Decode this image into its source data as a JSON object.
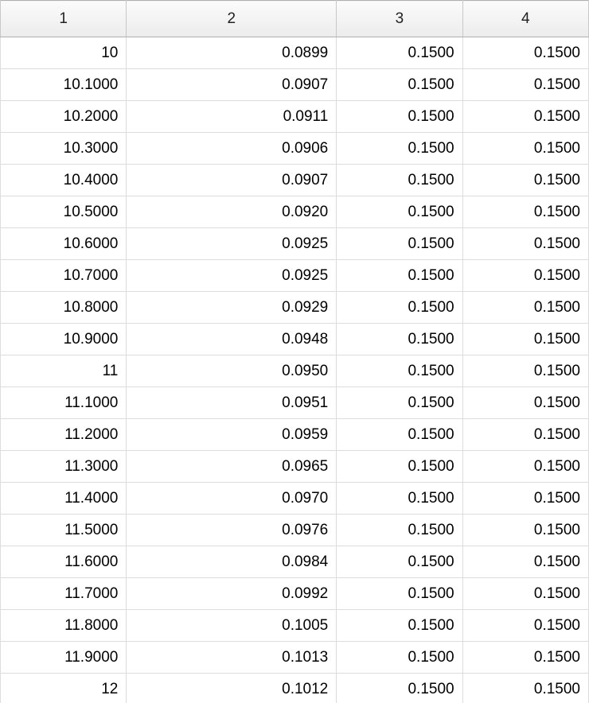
{
  "table": {
    "headers": [
      "1",
      "2",
      "3",
      "4"
    ],
    "rows": [
      [
        "10",
        "0.0899",
        "0.1500",
        "0.1500"
      ],
      [
        "10.1000",
        "0.0907",
        "0.1500",
        "0.1500"
      ],
      [
        "10.2000",
        "0.0911",
        "0.1500",
        "0.1500"
      ],
      [
        "10.3000",
        "0.0906",
        "0.1500",
        "0.1500"
      ],
      [
        "10.4000",
        "0.0907",
        "0.1500",
        "0.1500"
      ],
      [
        "10.5000",
        "0.0920",
        "0.1500",
        "0.1500"
      ],
      [
        "10.6000",
        "0.0925",
        "0.1500",
        "0.1500"
      ],
      [
        "10.7000",
        "0.0925",
        "0.1500",
        "0.1500"
      ],
      [
        "10.8000",
        "0.0929",
        "0.1500",
        "0.1500"
      ],
      [
        "10.9000",
        "0.0948",
        "0.1500",
        "0.1500"
      ],
      [
        "11",
        "0.0950",
        "0.1500",
        "0.1500"
      ],
      [
        "11.1000",
        "0.0951",
        "0.1500",
        "0.1500"
      ],
      [
        "11.2000",
        "0.0959",
        "0.1500",
        "0.1500"
      ],
      [
        "11.3000",
        "0.0965",
        "0.1500",
        "0.1500"
      ],
      [
        "11.4000",
        "0.0970",
        "0.1500",
        "0.1500"
      ],
      [
        "11.5000",
        "0.0976",
        "0.1500",
        "0.1500"
      ],
      [
        "11.6000",
        "0.0984",
        "0.1500",
        "0.1500"
      ],
      [
        "11.7000",
        "0.0992",
        "0.1500",
        "0.1500"
      ],
      [
        "11.8000",
        "0.1005",
        "0.1500",
        "0.1500"
      ],
      [
        "11.9000",
        "0.1013",
        "0.1500",
        "0.1500"
      ],
      [
        "12",
        "0.1012",
        "0.1500",
        "0.1500"
      ]
    ]
  }
}
